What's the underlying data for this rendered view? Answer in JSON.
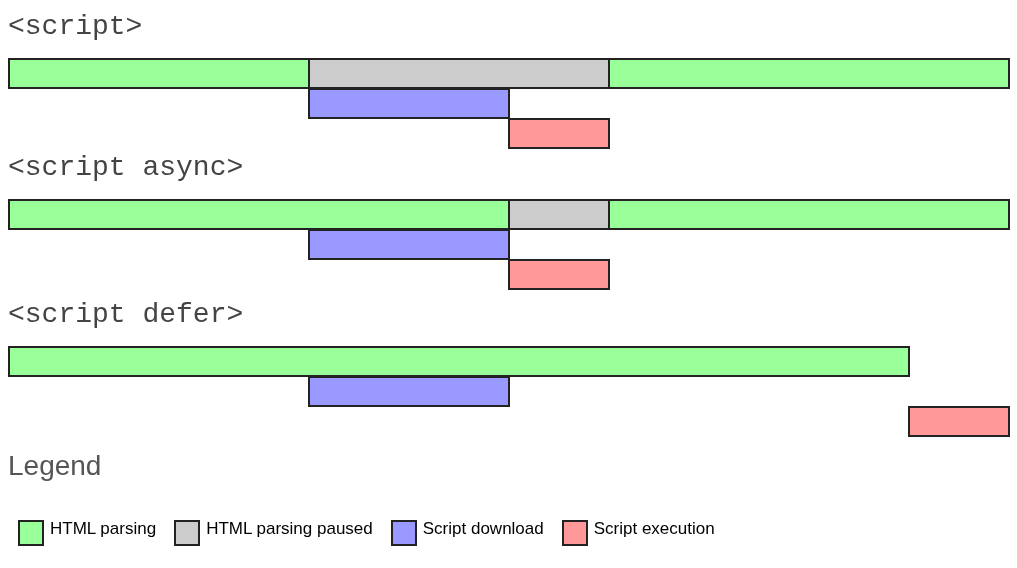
{
  "sections": [
    {
      "title": "<script>"
    },
    {
      "title": "<script async>"
    },
    {
      "title": "<script defer>"
    }
  ],
  "legend": {
    "title": "Legend",
    "items": [
      {
        "kind": "parsing",
        "label": "HTML parsing",
        "color": "#99ff99"
      },
      {
        "kind": "paused",
        "label": "HTML parsing paused",
        "color": "#cccccc"
      },
      {
        "kind": "download",
        "label": "Script download",
        "color": "#9999ff"
      },
      {
        "kind": "execution",
        "label": "Script execution",
        "color": "#ff9999"
      }
    ]
  }
}
